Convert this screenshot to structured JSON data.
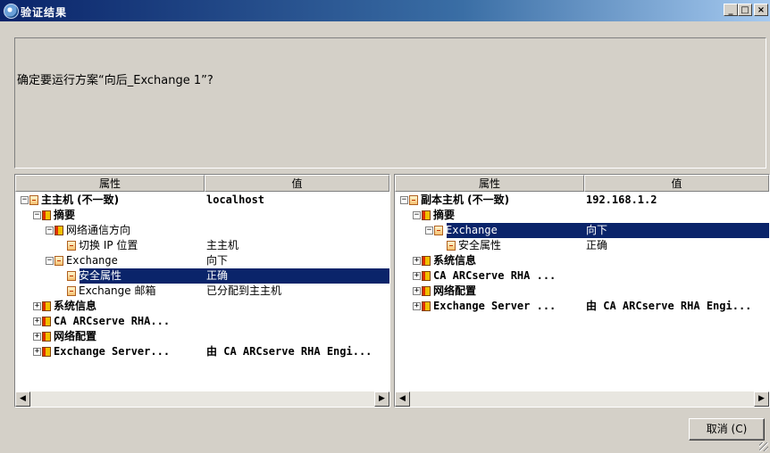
{
  "window": {
    "title": "验证结果",
    "min": "_",
    "max": "□",
    "close": "×"
  },
  "question": "确定要运行方案“向后_Exchange 1”?",
  "columns": {
    "property": "属性",
    "value": "值"
  },
  "left_panel": {
    "rows": [
      {
        "indent": 0,
        "expander": "⊟",
        "icon": "doc",
        "label": "主主机 (不一致)",
        "value": "localhost",
        "bold": true,
        "value_bold": true,
        "value_mono": true
      },
      {
        "indent": 1,
        "expander": "⊟",
        "icon": "book",
        "label": "摘要",
        "value": "",
        "bold": true
      },
      {
        "indent": 2,
        "expander": "⊟",
        "icon": "book",
        "label": "网络通信方向",
        "value": ""
      },
      {
        "indent": 3,
        "expander": "",
        "icon": "doc",
        "label": "切换 IP 位置",
        "value": "主主机"
      },
      {
        "indent": 2,
        "expander": "⊟",
        "icon": "doc",
        "label": "Exchange",
        "value": "向下",
        "label_mono": true
      },
      {
        "indent": 3,
        "expander": "",
        "icon": "doc",
        "label": "安全属性",
        "value": "正确",
        "selected": true
      },
      {
        "indent": 3,
        "expander": "",
        "icon": "doc",
        "label": "Exchange 邮箱",
        "value": "已分配到主主机"
      },
      {
        "indent": 1,
        "expander": "⊞",
        "icon": "book",
        "label": "系统信息",
        "value": "",
        "bold": true
      },
      {
        "indent": 1,
        "expander": "⊞",
        "icon": "book",
        "label": "CA ARCserve RHA...",
        "value": "",
        "bold": true,
        "label_mono": true
      },
      {
        "indent": 1,
        "expander": "⊞",
        "icon": "book",
        "label": "网络配置",
        "value": "",
        "bold": true
      },
      {
        "indent": 1,
        "expander": "⊞",
        "icon": "book",
        "label": "Exchange Server...",
        "value": "由 CA ARCserve RHA Engi...",
        "bold": true,
        "label_mono": true,
        "value_bold": true,
        "value_mono": true
      }
    ]
  },
  "right_panel": {
    "rows": [
      {
        "indent": 0,
        "expander": "⊟",
        "icon": "doc",
        "label": "副本主机 (不一致)",
        "value": "192.168.1.2",
        "bold": true,
        "value_bold": true,
        "value_mono": true
      },
      {
        "indent": 1,
        "expander": "⊟",
        "icon": "book",
        "label": "摘要",
        "value": "",
        "bold": true
      },
      {
        "indent": 2,
        "expander": "⊟",
        "icon": "doc",
        "label": "Exchange",
        "value": "向下",
        "label_mono": true,
        "selected": true
      },
      {
        "indent": 3,
        "expander": "",
        "icon": "doc",
        "label": "安全属性",
        "value": "正确"
      },
      {
        "indent": 1,
        "expander": "⊞",
        "icon": "book",
        "label": "系统信息",
        "value": "",
        "bold": true
      },
      {
        "indent": 1,
        "expander": "⊞",
        "icon": "book",
        "label": "CA ARCserve RHA ...",
        "value": "",
        "bold": true,
        "label_mono": true
      },
      {
        "indent": 1,
        "expander": "⊞",
        "icon": "book",
        "label": "网络配置",
        "value": "",
        "bold": true
      },
      {
        "indent": 1,
        "expander": "⊞",
        "icon": "book",
        "label": "Exchange Server ...",
        "value": "由 CA ARCserve RHA Engi...",
        "bold": true,
        "label_mono": true,
        "value_bold": true,
        "value_mono": true
      }
    ]
  },
  "scroll": {
    "left": "◀",
    "right": "▶"
  },
  "cancel_button": "取消 (C)"
}
